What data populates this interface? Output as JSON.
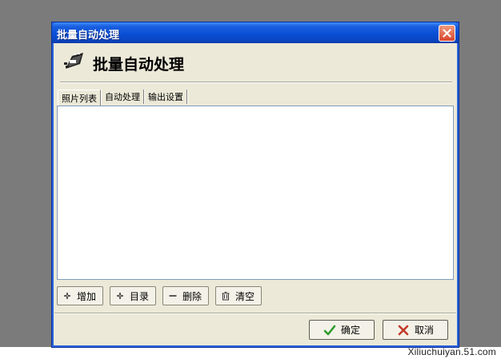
{
  "window": {
    "title": "批量自动处理"
  },
  "header": {
    "title": "批量自动处理",
    "icon": "film-roll-icon"
  },
  "tabs": [
    {
      "label": "照片列表",
      "active": true
    },
    {
      "label": "自动处理",
      "active": false
    },
    {
      "label": "输出设置",
      "active": false
    }
  ],
  "toolbar": {
    "add_label": "增加",
    "dir_label": "目录",
    "delete_label": "删除",
    "clear_label": "清空"
  },
  "actions": {
    "ok_label": "确定",
    "cancel_label": "取消"
  },
  "watermark": "Xiliuchuiyan.51.com",
  "colors": {
    "titlebar": "#0a4fd6",
    "dialog_bg": "#ece9d8",
    "ok_check": "#2f9a2f",
    "cancel_x": "#c23a2a"
  }
}
